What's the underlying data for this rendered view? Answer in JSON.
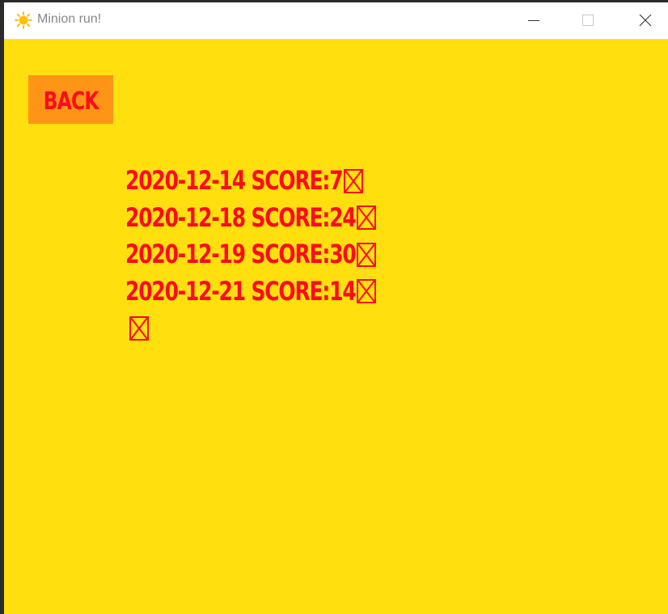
{
  "window": {
    "title": "Minion run!",
    "app_icon": "sun-icon",
    "controls": [
      "minimize-icon",
      "maximize-icon",
      "close-icon"
    ]
  },
  "colors": {
    "background": "#ffdf0e",
    "button_background": "#ff9516",
    "text": "#ff0a1c"
  },
  "back_button": {
    "label": "BACK"
  },
  "scores": [
    {
      "text": "2020-12-14 SCORE:7",
      "glyph": "missing-glyph-icon"
    },
    {
      "text": "2020-12-18 SCORE:24",
      "glyph": "missing-glyph-icon"
    },
    {
      "text": "2020-12-19 SCORE:30",
      "glyph": "missing-glyph-icon"
    },
    {
      "text": "2020-12-21 SCORE:14",
      "glyph": "missing-glyph-icon"
    },
    {
      "text": "",
      "glyph": "missing-glyph-icon"
    }
  ]
}
